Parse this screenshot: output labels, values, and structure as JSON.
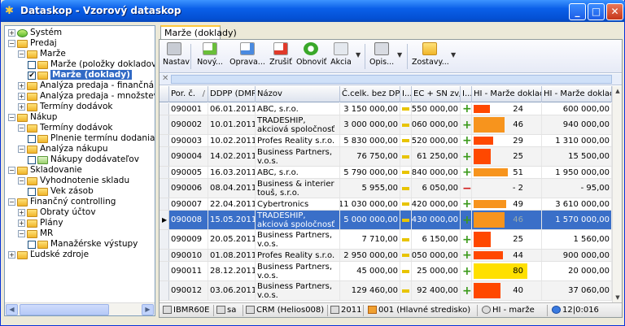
{
  "window": {
    "title": "Dataskop - Vzorový dataskop"
  },
  "tree": [
    {
      "label": "Systém",
      "level": 0,
      "expander": "+",
      "icon": "green"
    },
    {
      "label": "Predaj",
      "level": 0,
      "expander": "-",
      "icon": "folder"
    },
    {
      "label": "Marže",
      "level": 1,
      "expander": "-",
      "icon": "folder"
    },
    {
      "label": "Marže (položky dokladov)",
      "level": 2,
      "check": "",
      "icon": "folder"
    },
    {
      "label": "Marže (doklady)",
      "level": 2,
      "check": "✔",
      "icon": "folder",
      "selected": true
    },
    {
      "label": "Analýza predaja - finančná (HD)",
      "level": 1,
      "expander": "+",
      "icon": "folder"
    },
    {
      "label": "Analýza predaja - množstevná (P",
      "level": 1,
      "expander": "+",
      "icon": "folder"
    },
    {
      "label": "Termíny dodávok",
      "level": 1,
      "expander": "+",
      "icon": "folder"
    },
    {
      "label": "Nákup",
      "level": 0,
      "expander": "-",
      "icon": "folder"
    },
    {
      "label": "Termíny dodávok",
      "level": 1,
      "expander": "-",
      "icon": "folder"
    },
    {
      "label": "Plnenie termínu dodania -",
      "level": 2,
      "check": "",
      "icon": "folder"
    },
    {
      "label": "Analýza nákupu",
      "level": 1,
      "expander": "-",
      "icon": "folder"
    },
    {
      "label": "Nákupy dodávateľov",
      "level": 2,
      "check": "",
      "icon": "grid"
    },
    {
      "label": "Skladovanie",
      "level": 0,
      "expander": "-",
      "icon": "folder"
    },
    {
      "label": "Vyhodnotenie skladu",
      "level": 1,
      "expander": "-",
      "icon": "folder"
    },
    {
      "label": "Vek zásob",
      "level": 2,
      "check": "",
      "icon": "folder"
    },
    {
      "label": "Finančný controlling",
      "level": 0,
      "expander": "-",
      "icon": "folder"
    },
    {
      "label": "Obraty účtov",
      "level": 1,
      "expander": "+",
      "icon": "folder"
    },
    {
      "label": "Plány",
      "level": 1,
      "expander": "+",
      "icon": "folder"
    },
    {
      "label": "MR",
      "level": 1,
      "expander": "-",
      "icon": "folder"
    },
    {
      "label": "Manažérske výstupy",
      "level": 2,
      "check": "",
      "icon": "folder"
    },
    {
      "label": "Ľudské zdroje",
      "level": 0,
      "expander": "+",
      "icon": "folder"
    }
  ],
  "tab": {
    "label": "Marže (doklady)"
  },
  "toolbar": {
    "nastav": "Nastav",
    "novy": "Nový...",
    "oprava": "Oprava...",
    "zrusit": "Zrušiť",
    "obnovit": "Obnoviť",
    "akcia": "Akcia",
    "opis": "Opis...",
    "zostavy": "Zostavy..."
  },
  "columns": [
    "Por. č.",
    "DDPP (DMR)",
    "Názov",
    "Č.celk. bez DP...",
    "I...",
    "EC + SN zv/sn",
    "I...",
    "HI - Marže doklad %",
    "HI - Marže doklad"
  ],
  "sort_indicator": "/",
  "colors": {
    "selection": "#3a6fc8",
    "bar_orange": "#f7941d",
    "bar_red": "#ff4800",
    "bar_yellow": "#ffe000"
  },
  "rows": [
    {
      "por": "090001",
      "date": "06.01.2011",
      "name": "ABC, s.r.o.",
      "total": "3 150 000,00",
      "ec": "2 550 000,00",
      "sign": "+",
      "pct": "24",
      "pct_val": 24,
      "marza": "600 000,00",
      "lines": 1
    },
    {
      "por": "090002",
      "date": "10.01.2011",
      "name": "TRADESHIP, akciová spoločnosť",
      "total": "3 000 000,00",
      "ec": "2 060 000,00",
      "sign": "+",
      "pct": "46",
      "pct_val": 46,
      "marza": "940 000,00",
      "lines": 2
    },
    {
      "por": "090003",
      "date": "10.02.2011",
      "name": "Profes Reality s.r.o.",
      "total": "5 830 000,00",
      "ec": "4 520 000,00",
      "sign": "+",
      "pct": "29",
      "pct_val": 29,
      "marza": "1 310 000,00",
      "lines": 1
    },
    {
      "por": "090004",
      "date": "14.02.2011",
      "name": "Business Partners, v.o.s.",
      "total": "76 750,00",
      "ec": "61 250,00",
      "sign": "+",
      "pct": "25",
      "pct_val": 25,
      "marza": "15 500,00",
      "lines": 2
    },
    {
      "por": "090005",
      "date": "16.03.2011",
      "name": "ABC, s.r.o.",
      "total": "5 790 000,00",
      "ec": "3 840 000,00",
      "sign": "+",
      "pct": "51",
      "pct_val": 51,
      "marza": "1 950 000,00",
      "lines": 1
    },
    {
      "por": "090006",
      "date": "08.04.2011",
      "name": "Business & interier touš, s.r.o.",
      "total": "5 955,00",
      "ec": "6 050,00",
      "sign": "-",
      "pct": "-  2",
      "pct_val": -2,
      "marza": "-  95,00",
      "lines": 2
    },
    {
      "por": "090007",
      "date": "22.04.2011",
      "name": "Cybertronics",
      "total": "11 030 000,00",
      "ec": "7 420 000,00",
      "sign": "+",
      "pct": "49",
      "pct_val": 49,
      "marza": "3 610 000,00",
      "lines": 1
    },
    {
      "por": "090008",
      "date": "15.05.2011",
      "name": "TRADESHIP, akciová spoločnosť",
      "total": "5 000 000,00",
      "ec": "3 430 000,00",
      "sign": "+",
      "pct": "46",
      "pct_val": 46,
      "marza": "1 570 000,00",
      "lines": 2,
      "selected": true
    },
    {
      "por": "090009",
      "date": "20.05.2011",
      "name": "Business Partners, v.o.s.",
      "total": "7 710,00",
      "ec": "6 150,00",
      "sign": "+",
      "pct": "25",
      "pct_val": 25,
      "marza": "1 560,00",
      "lines": 2
    },
    {
      "por": "090010",
      "date": "01.08.2011",
      "name": "Profes Reality s.r.o.",
      "total": "2 950 000,00",
      "ec": "2 050 000,00",
      "sign": "+",
      "pct": "44",
      "pct_val": 44,
      "marza": "900 000,00",
      "lines": 1
    },
    {
      "por": "090011",
      "date": "28.12.2011",
      "name": "Business Partners, v.o.s.",
      "total": "45 000,00",
      "ec": "25 000,00",
      "sign": "+",
      "pct": "80",
      "pct_val": 80,
      "marza": "20 000,00",
      "lines": 2
    },
    {
      "por": "090012",
      "date": "03.06.2011",
      "name": "Business Partners, v.o.s.",
      "total": "129 460,00",
      "ec": "92 400,00",
      "sign": "+",
      "pct": "40",
      "pct_val": 40,
      "marza": "37 060,00",
      "lines": 2
    }
  ],
  "status": {
    "db": "IBMR60E",
    "user": "sa",
    "crm": "CRM (Helios008)",
    "year": "2011",
    "center": "001 (Hlavné stredisko)",
    "view": "HI - marže",
    "count": "12|0:016"
  }
}
